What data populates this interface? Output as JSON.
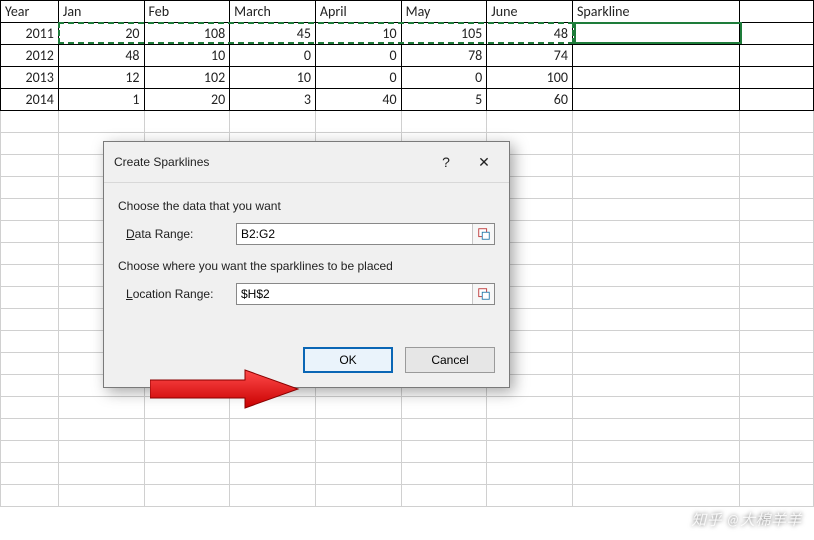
{
  "grid": {
    "headers": [
      "Year",
      "Jan",
      "Feb",
      "March",
      "April",
      "May",
      "June"
    ],
    "sparkline_header": "Sparkline",
    "rows": [
      {
        "year": "2011",
        "vals": [
          20,
          108,
          45,
          10,
          105,
          48
        ]
      },
      {
        "year": "2012",
        "vals": [
          48,
          10,
          0,
          0,
          78,
          74
        ]
      },
      {
        "year": "2013",
        "vals": [
          12,
          102,
          10,
          0,
          0,
          100
        ]
      },
      {
        "year": "2014",
        "vals": [
          1,
          20,
          3,
          40,
          5,
          60
        ]
      }
    ]
  },
  "dialog": {
    "title": "Create Sparklines",
    "help_glyph": "?",
    "close_glyph": "✕",
    "group1": "Choose the data that you want",
    "data_range_label": "Data Range:",
    "data_range_value": "B2:G2",
    "group2": "Choose where you want the sparklines to be placed",
    "location_range_label": "Location Range:",
    "location_range_value": "$H$2",
    "ok": "OK",
    "cancel": "Cancel"
  },
  "watermark": "知乎 @大棉羊羊"
}
